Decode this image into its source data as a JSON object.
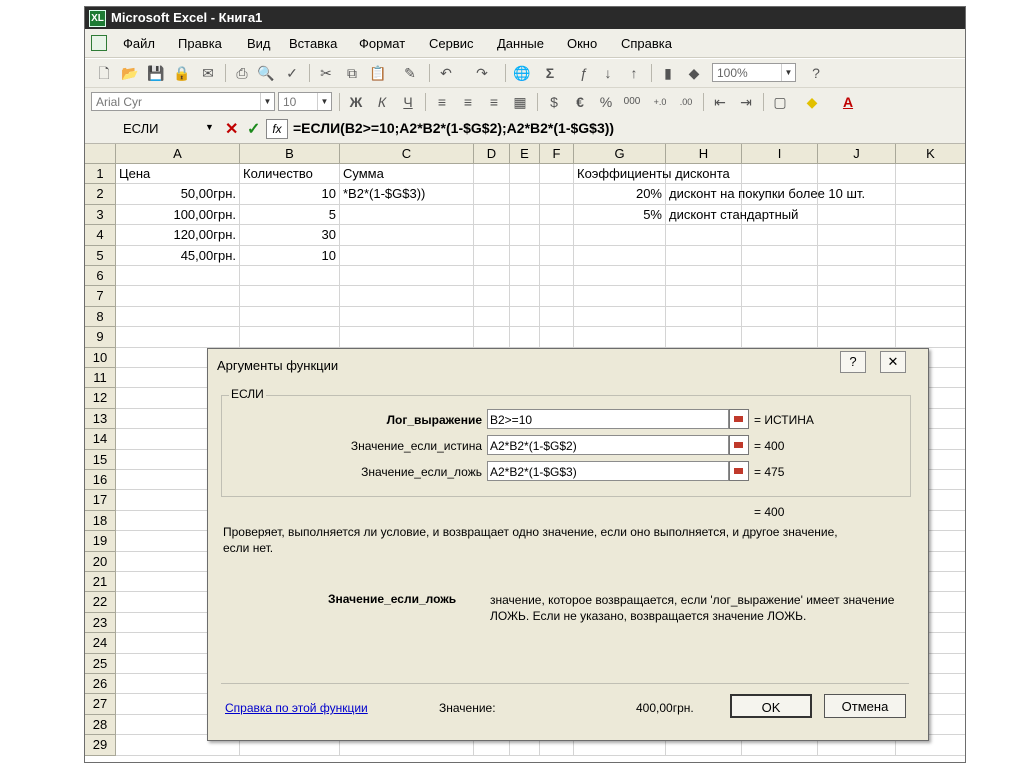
{
  "window": {
    "title": "Microsoft Excel - Книга1",
    "logo": "XL"
  },
  "menu": [
    "Файл",
    "Правка",
    "Вид",
    "Вставка",
    "Формат",
    "Сервис",
    "Данные",
    "Окно",
    "Справка"
  ],
  "toolbar": {
    "zoom": "100%",
    "font_name": "Arial Cyr",
    "font_size": "10",
    "bold_label": "Ж",
    "italic_label": "К",
    "underline_label": "Ч",
    "currency_label": "€",
    "percent_label": "%",
    "thousands_label": "000",
    "autosum_label": "Σ",
    "font_color_label": "A"
  },
  "formula_bar": {
    "name_box": "ЕСЛИ",
    "formula": "=ЕСЛИ(B2>=10;A2*B2*(1-$G$2);A2*B2*(1-$G$3))",
    "fx_label": "fx",
    "cancel_label": "✕",
    "enter_label": "✓"
  },
  "columns": [
    "A",
    "B",
    "C",
    "D",
    "E",
    "F",
    "G",
    "H",
    "I",
    "J",
    "K"
  ],
  "rows": [
    "1",
    "2",
    "3",
    "4",
    "5",
    "6",
    "7",
    "8",
    "9",
    "10",
    "11",
    "12",
    "13",
    "14",
    "15",
    "16",
    "17",
    "18",
    "19",
    "20",
    "21",
    "22",
    "23",
    "24",
    "25",
    "26",
    "27",
    "28",
    "29"
  ],
  "cells": {
    "A1": "Цена",
    "B1": "Количество",
    "C1": "Сумма",
    "G1": "Коэффициенты дисконта",
    "A2": "50,00грн.",
    "B2": "10",
    "C2": "*B2*(1-$G$3))",
    "G2": "20%",
    "H2": "дисконт на покупки более 10 шт.",
    "A3": "100,00грн.",
    "B3": "5",
    "G3": "5%",
    "H3": "дисконт стандартный",
    "A4": "120,00грн.",
    "B4": "30",
    "A5": "45,00грн.",
    "B5": "10"
  },
  "dialog": {
    "title": "Аргументы функции",
    "help_btn": "?",
    "close_btn": "✕",
    "group_label": "ЕСЛИ",
    "args": [
      {
        "label": "Лог_выражение",
        "value": "B2>=10",
        "result": "= ИСТИНА"
      },
      {
        "label": "Значение_если_истина",
        "value": "A2*B2*(1-$G$2)",
        "result": "= 400"
      },
      {
        "label": "Значение_если_ложь",
        "value": "A2*B2*(1-$G$3)",
        "result": "= 475"
      }
    ],
    "total": "= 400",
    "description": "Проверяет, выполняется ли условие, и возвращает одно значение, если оно выполняется, и другое значение, если нет.",
    "arg_help_title": "Значение_если_ложь",
    "arg_help_text": "значение, которое возвращается, если 'лог_выражение' имеет значение ЛОЖЬ. Если не указано, возвращается значение ЛОЖЬ.",
    "help_link": "Справка по этой функции",
    "value_label": "Значение:",
    "value": "400,00грн.",
    "ok": "OK",
    "cancel": "Отмена"
  }
}
